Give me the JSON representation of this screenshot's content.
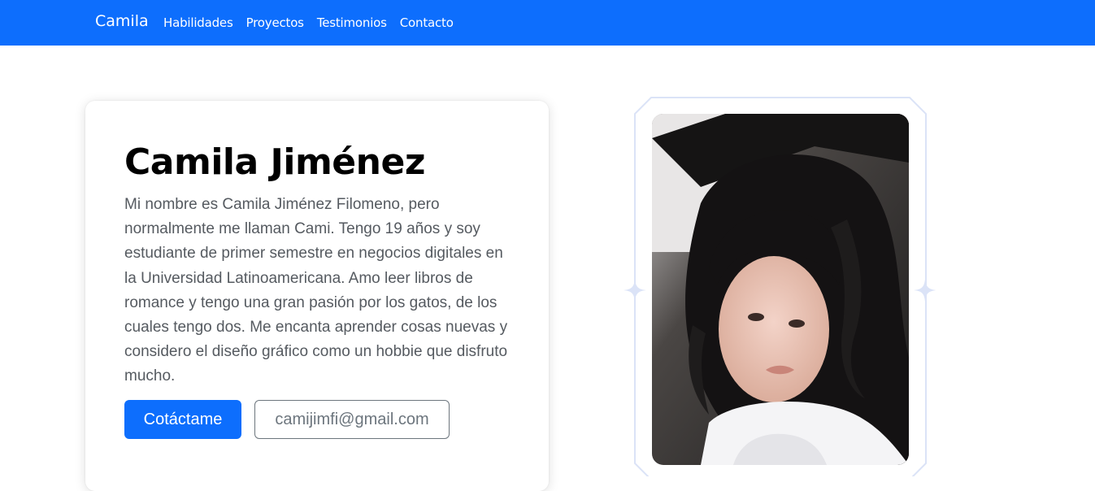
{
  "navbar": {
    "brand": "Camila",
    "links": [
      "Habilidades",
      "Proyectos",
      "Testimonios",
      "Contacto"
    ],
    "background_color": "#0d6efd"
  },
  "hero": {
    "name": "Camila Jiménez",
    "bio": "Mi nombre es Camila Jiménez Filomeno, pero normalmente me llaman Cami. Tengo 19 años y soy estudiante de primer semestre en negocios digitales en la Universidad Latinoamericana. Amo leer libros de romance y tengo una gran pasión por los gatos, de los cuales tengo dos. Me encanta aprender cosas nuevas y considero el diseño gráfico como un hobbie que disfruto mucho.",
    "contact_button": "Cotáctame",
    "email_button": "camijimfi@gmail.com",
    "accent_color": "#0d6efd"
  },
  "portrait": {
    "frame_icon": "sparkle-icon",
    "frame_color": "#dbe3f7"
  }
}
